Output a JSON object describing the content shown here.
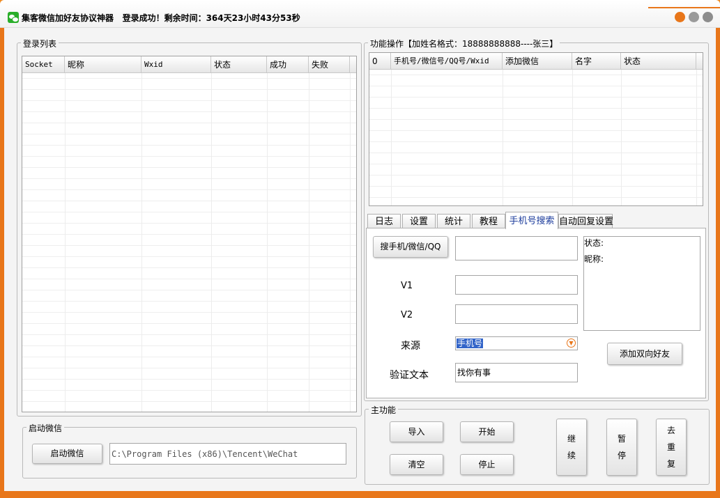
{
  "window": {
    "title": "集客微信加好友协议神器",
    "status": "登录成功！剩余时间：364天23小时43分53秒",
    "colors": {
      "frame": "#e8761a",
      "close": "#e8761a",
      "minimize": "#9a9a9a",
      "maximize": "#9a9a9a"
    }
  },
  "login_list": {
    "label": "登录列表",
    "columns": [
      "Socket",
      "昵称",
      "Wxid",
      "状态",
      "成功",
      "失败"
    ]
  },
  "func_ops": {
    "label": "功能操作【加姓名格式：18888888888----张三】",
    "columns": [
      "0",
      "手机号/微信号/QQ号/Wxid",
      "添加微信",
      "名字",
      "状态"
    ]
  },
  "tabs": [
    "日志",
    "设置",
    "统计",
    "教程",
    "手机号搜索",
    "自动回复设置"
  ],
  "search_panel": {
    "search_button": "搜手机/微信/QQ",
    "v1_label": "V1",
    "v2_label": "V2",
    "source_label": "来源",
    "source_value": "手机号",
    "verify_label": "验证文本",
    "verify_value": "找你有事",
    "info_status": "状态:",
    "info_nickname": "昵称:",
    "add_friend_button": "添加双向好友"
  },
  "start_wechat": {
    "label": "启动微信",
    "button": "启动微信",
    "path": "C:\\Program Files (x86)\\Tencent\\WeChat"
  },
  "main_functions": {
    "label": "主功能",
    "import": "导入",
    "start": "开始",
    "clear": "清空",
    "stop": "停止",
    "continue_c1": "继",
    "continue_c2": "续",
    "pause_c1": "暂",
    "pause_c2": "停",
    "dedupe_c1": "去",
    "dedupe_c2": "重",
    "dedupe_c3": "复"
  }
}
